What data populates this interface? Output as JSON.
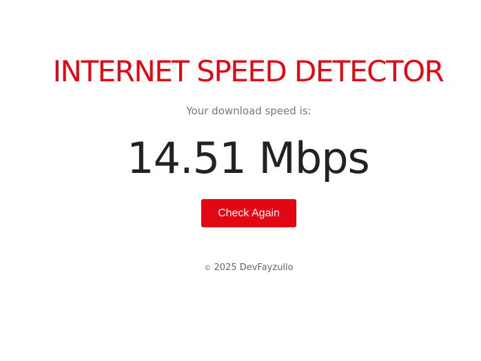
{
  "header": {
    "title": "INTERNET SPEED DETECTOR"
  },
  "result": {
    "label": "Your download speed is:",
    "speed": "14.51 Mbps"
  },
  "actions": {
    "check_again_label": "Check Again"
  },
  "footer": {
    "copyright_symbol": "©",
    "text": " 2025 DevFayzullo"
  },
  "colors": {
    "accent": "#e30613",
    "text_dark": "#222222",
    "text_muted": "#777777",
    "footer_text": "#666666",
    "button_text": "#ffffff"
  }
}
